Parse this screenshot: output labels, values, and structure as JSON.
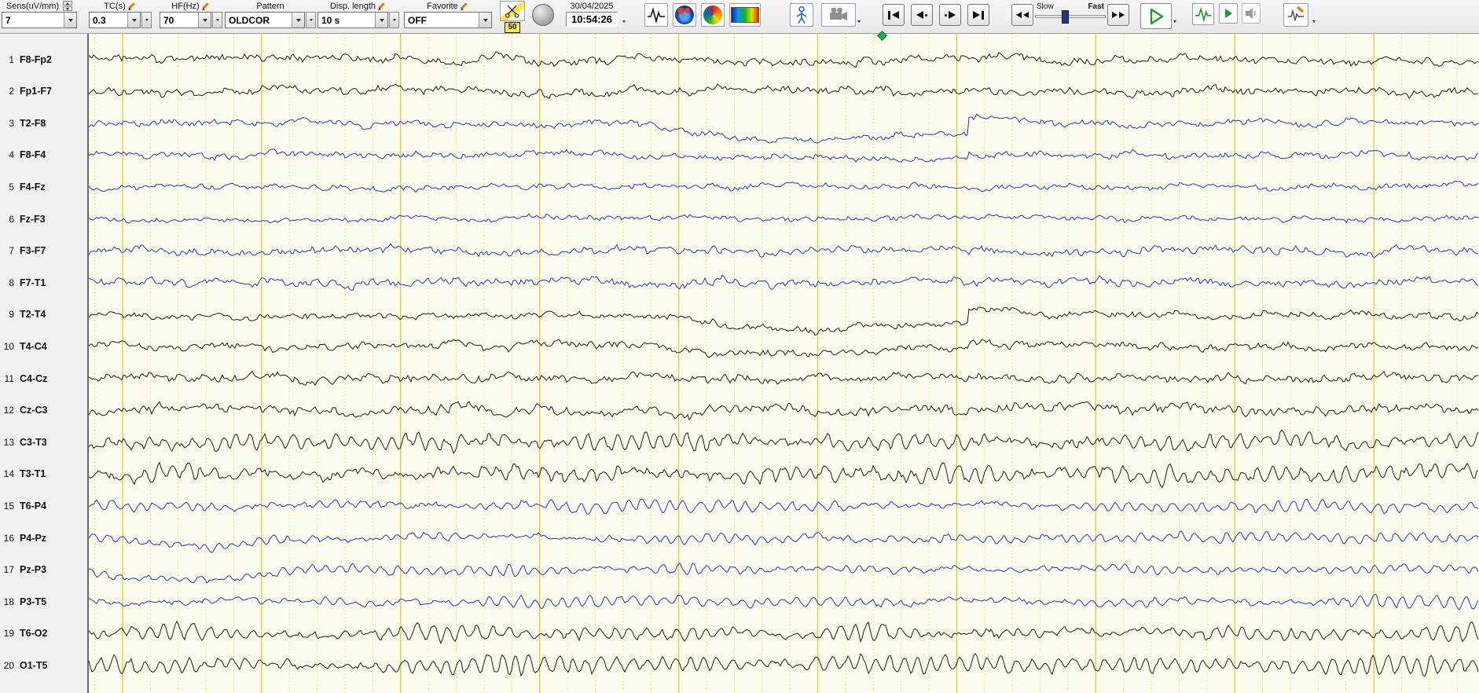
{
  "toolbar": {
    "sens": {
      "label": "Sens(uV/mm)",
      "value": "7"
    },
    "tc": {
      "label": "TC(s)",
      "value": "0.3"
    },
    "hf": {
      "label": "HF(Hz)",
      "value": "70"
    },
    "pattern": {
      "label": "Pattern",
      "value": "OLDCOR"
    },
    "disp_length": {
      "label": "Disp. length",
      "value": "10 s"
    },
    "favorite": {
      "label": "Favorite",
      "value": "OFF"
    },
    "notch_badge": "50",
    "date": "30/04/2025",
    "time": "10:54:26",
    "speed_slow": "Slow",
    "speed_fast": "Fast",
    "slider_position": 0.42,
    "icons": [
      "scissors",
      "globe",
      "signal",
      "brain-map",
      "color-swirl",
      "spectrum",
      "patient",
      "video-camera",
      "skip-start",
      "step-back",
      "step-forward",
      "skip-end",
      "rewind",
      "fast-forward",
      "play",
      "signal-green",
      "play-small",
      "speaker",
      "montage-tools"
    ]
  },
  "display": {
    "seconds_shown": 10,
    "grid_color_major": "#e0c929",
    "grid_color_minor": "#ecdf74",
    "background": "#fcfcee",
    "trace_black": "#1a1a1a",
    "trace_blue": "#2236c4"
  },
  "marker": {
    "position_fraction": 0.571,
    "color": "#1fb04a"
  },
  "channels": [
    {
      "num": "1",
      "label": "F8-Fp2",
      "color": "#1a1a1a",
      "amp": 5,
      "alphaAmp": 0,
      "event": "none",
      "depth": 0
    },
    {
      "num": "2",
      "label": "Fp1-F7",
      "color": "#1a1a1a",
      "amp": 5,
      "alphaAmp": 0,
      "event": "none",
      "depth": 0
    },
    {
      "num": "3",
      "label": "T2-F8",
      "color": "#2236c4",
      "amp": 4,
      "alphaAmp": 0,
      "event": "mid",
      "depth": 24
    },
    {
      "num": "4",
      "label": "F8-F4",
      "color": "#2236c4",
      "amp": 4,
      "alphaAmp": 0,
      "event": "mid",
      "depth": 6
    },
    {
      "num": "5",
      "label": "F4-Fz",
      "color": "#2236c4",
      "amp": 3.5,
      "alphaAmp": 0,
      "event": "none",
      "depth": 0
    },
    {
      "num": "6",
      "label": "Fz-F3",
      "color": "#2236c4",
      "amp": 3.2,
      "alphaAmp": 0,
      "event": "none",
      "depth": 0
    },
    {
      "num": "7",
      "label": "F3-F7",
      "color": "#2236c4",
      "amp": 4.5,
      "alphaAmp": 2,
      "event": "none",
      "depth": 0
    },
    {
      "num": "8",
      "label": "F7-T1",
      "color": "#2236c4",
      "amp": 4.5,
      "alphaAmp": 2,
      "event": "none",
      "depth": 0
    },
    {
      "num": "9",
      "label": "T2-T4",
      "color": "#1a1a1a",
      "amp": 4,
      "alphaAmp": 0,
      "event": "mid",
      "depth": 20
    },
    {
      "num": "10",
      "label": "T4-C4",
      "color": "#1a1a1a",
      "amp": 4.5,
      "alphaAmp": 0,
      "event": "mid",
      "depth": 10
    },
    {
      "num": "11",
      "label": "C4-Cz",
      "color": "#1a1a1a",
      "amp": 5,
      "alphaAmp": 2,
      "event": "none",
      "depth": 0
    },
    {
      "num": "12",
      "label": "Cz-C3",
      "color": "#1a1a1a",
      "amp": 5.5,
      "alphaAmp": 3,
      "event": "none",
      "depth": 0
    },
    {
      "num": "13",
      "label": "C3-T3",
      "color": "#1a1a1a",
      "amp": 5,
      "alphaAmp": 8,
      "event": "none",
      "depth": 0
    },
    {
      "num": "14",
      "label": "T3-T1",
      "color": "#1a1a1a",
      "amp": 6,
      "alphaAmp": 11,
      "event": "none",
      "depth": 0
    },
    {
      "num": "15",
      "label": "T6-P4",
      "color": "#2236c4",
      "amp": 3,
      "alphaAmp": 7,
      "event": "none",
      "depth": 0
    },
    {
      "num": "16",
      "label": "P4-Pz",
      "color": "#2236c4",
      "amp": 3,
      "alphaAmp": 5,
      "event": "left",
      "depth": 12
    },
    {
      "num": "17",
      "label": "Pz-P3",
      "color": "#2236c4",
      "amp": 3,
      "alphaAmp": 6,
      "event": "left",
      "depth": 15
    },
    {
      "num": "18",
      "label": "P3-T5",
      "color": "#2236c4",
      "amp": 3,
      "alphaAmp": 7,
      "event": "none",
      "depth": 0
    },
    {
      "num": "19",
      "label": "T6-O2",
      "color": "#1a1a1a",
      "amp": 4,
      "alphaAmp": 11,
      "event": "none",
      "depth": 0
    },
    {
      "num": "20",
      "label": "O1-T5",
      "color": "#1a1a1a",
      "amp": 4,
      "alphaAmp": 13,
      "event": "none",
      "depth": 0
    }
  ]
}
